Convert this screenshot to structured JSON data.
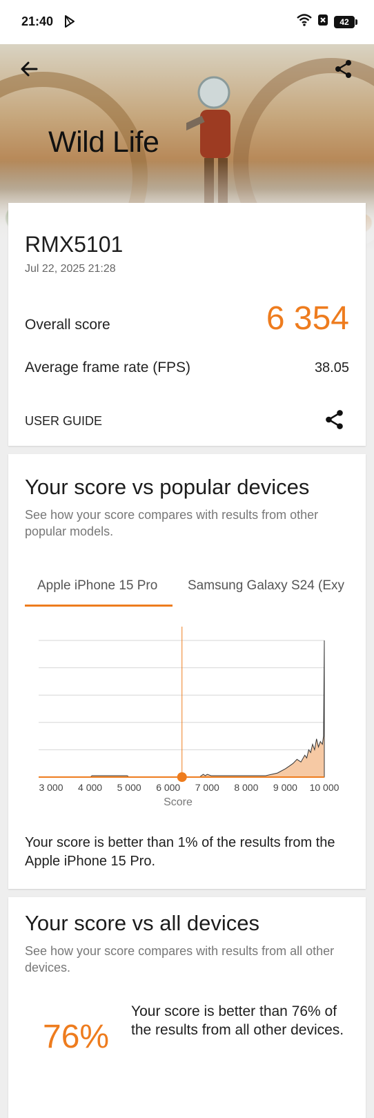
{
  "status_bar": {
    "time": "21:40",
    "battery": "42"
  },
  "header": {
    "title": "Wild Life"
  },
  "result_card": {
    "device": "RMX5101",
    "date": "Jul 22, 2025 21:28",
    "overall_label": "Overall score",
    "overall_value": "6 354",
    "fps_label": "Average frame rate (FPS)",
    "fps_value": "38.05",
    "user_guide": "USER GUIDE"
  },
  "popular": {
    "title": "Your score vs popular devices",
    "subtitle": "See how your score compares with results from other popular models.",
    "tabs": [
      "Apple iPhone 15 Pro",
      "Samsung Galaxy S24 (Exy"
    ],
    "result": "Your score is better than 1% of the results from the Apple iPhone 15 Pro."
  },
  "all_devices": {
    "title": "Your score vs all devices",
    "subtitle": "See how your score compares with results from all other devices.",
    "percent": "76%",
    "text": "Your score is better than 76% of the results from all other devices."
  },
  "chart_data": {
    "type": "area",
    "xlabel": "Score",
    "x_ticks": [
      "3 000",
      "4 000",
      "5 000",
      "6 000",
      "7 000",
      "8 000",
      "9 000",
      "10 000"
    ],
    "xlim": [
      3000,
      10000
    ],
    "grid": true,
    "marker": {
      "x": 6354
    },
    "series": [
      {
        "x": [
          3000,
          4000,
          4050,
          4100,
          4900,
          4950,
          5000,
          6300,
          6800,
          6900,
          6950,
          7000,
          7100,
          7500,
          8000,
          8500,
          8800,
          9000,
          9100,
          9200,
          9300,
          9400,
          9500,
          9550,
          9600,
          9650,
          9700,
          9750,
          9800,
          9850,
          9900,
          9950,
          9980,
          10000
        ],
        "y": [
          0,
          0,
          1,
          1,
          1,
          1,
          0,
          0,
          0,
          2,
          1,
          2,
          1,
          1,
          1,
          1,
          3,
          6,
          8,
          10,
          13,
          11,
          16,
          14,
          20,
          18,
          24,
          20,
          28,
          22,
          26,
          24,
          30,
          100
        ]
      }
    ]
  },
  "colors": {
    "accent": "#ee7c1e"
  },
  "icons": [
    "back-arrow-icon",
    "share-icon",
    "wifi-icon",
    "play-store-icon",
    "notification-icon",
    "battery-icon"
  ]
}
